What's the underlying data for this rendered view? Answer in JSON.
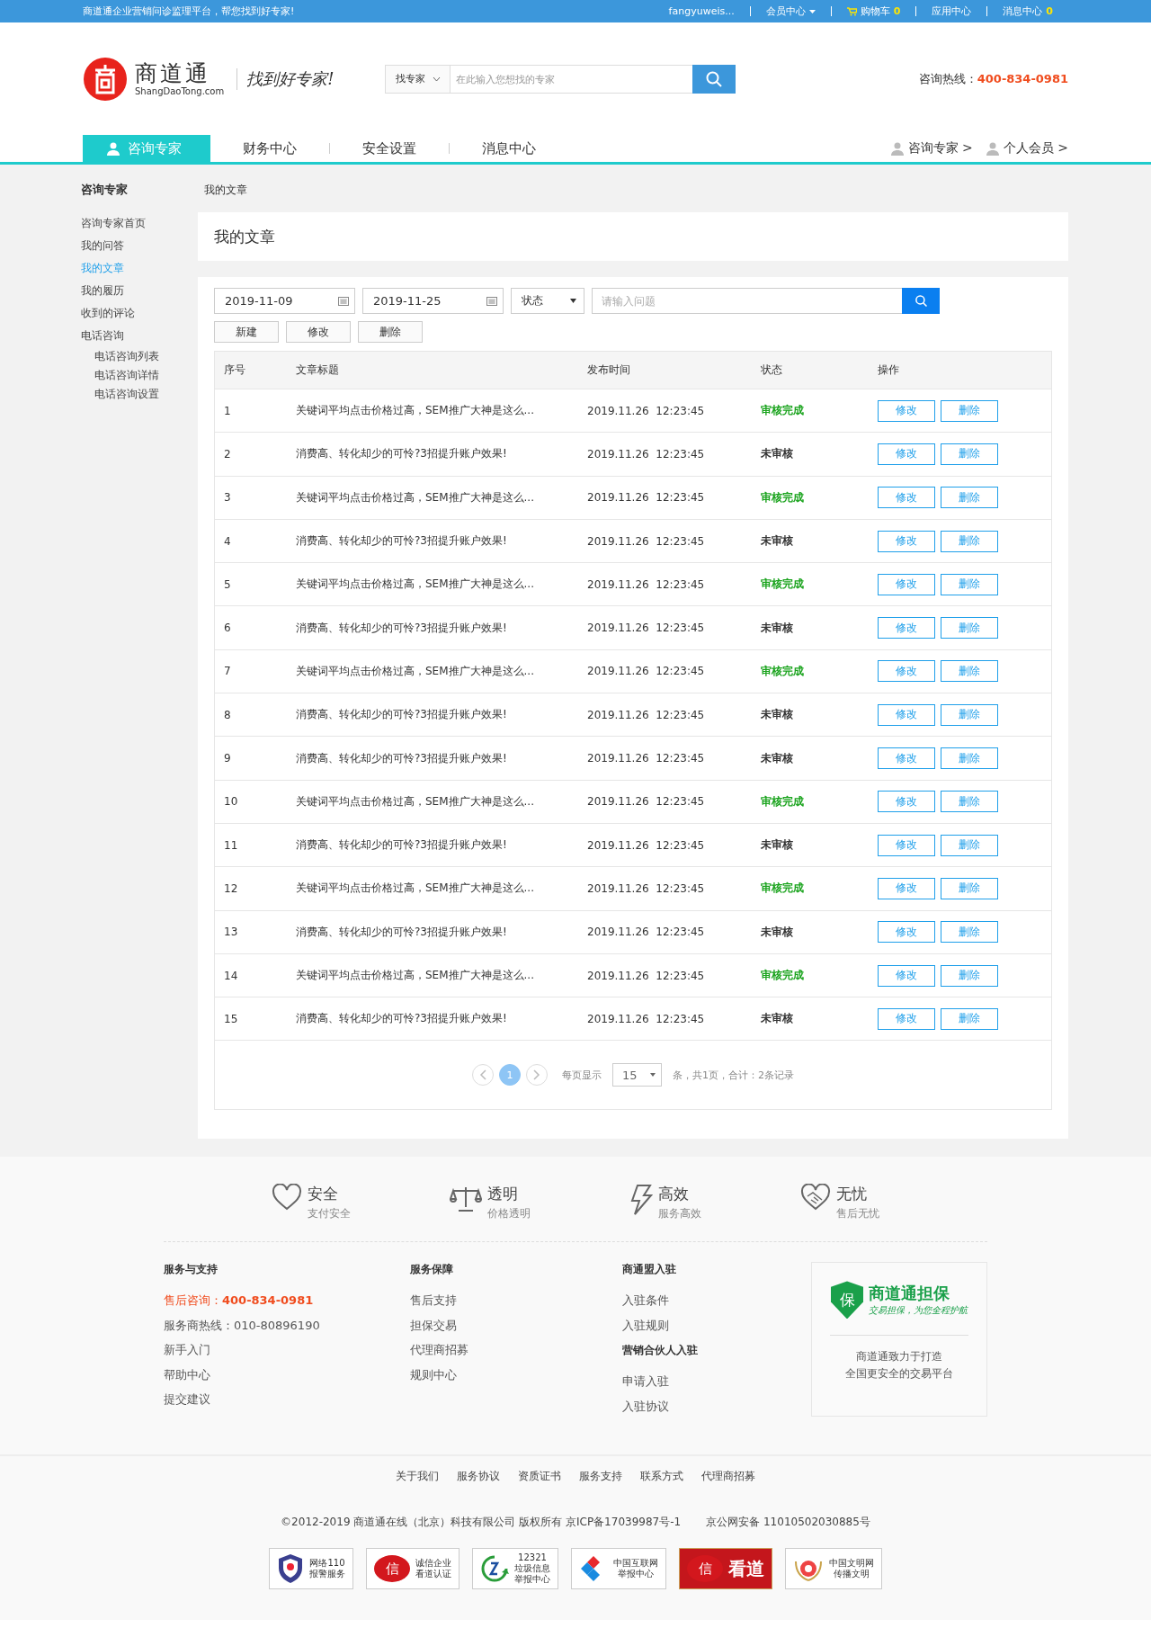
{
  "top_bar": {
    "slogan": "商道通企业营销问诊监理平台，帮您找到好专家!",
    "links": [
      {
        "kind": "text",
        "label": "fangyuweis..."
      },
      {
        "kind": "menu",
        "label": "会员中心"
      },
      {
        "kind": "cart",
        "label": "购物车",
        "count": "0"
      },
      {
        "kind": "text",
        "label": "应用中心"
      },
      {
        "kind": "count",
        "label": "消息中心",
        "count": "0"
      }
    ]
  },
  "header": {
    "logo": {
      "name": "商道通",
      "domain": "ShangDaoTong.com",
      "slogan": "找到好专家!"
    },
    "search": {
      "scope": "找专家",
      "placeholder": "在此输入您想找的专家"
    },
    "hotline": {
      "label": "咨询热线：",
      "number": "400-834-0981"
    }
  },
  "nav": {
    "tabs": [
      {
        "label": "咨询专家",
        "selected": true
      },
      {
        "label": "财务中心",
        "selected": false
      },
      {
        "label": "安全设置",
        "selected": false
      },
      {
        "label": "消息中心",
        "selected": false
      }
    ],
    "roles": [
      "咨询专家 >",
      "个人会员 >"
    ]
  },
  "sidebar": {
    "title": "咨询专家",
    "items": [
      {
        "label": "咨询专家首页",
        "selected": false
      },
      {
        "label": "我的问答",
        "selected": false
      },
      {
        "label": "我的文章",
        "selected": true
      },
      {
        "label": "我的履历",
        "selected": false
      },
      {
        "label": "收到的评论",
        "selected": false
      },
      {
        "label": "电话咨询",
        "selected": false,
        "children": [
          {
            "label": "电话咨询列表",
            "selected": false
          },
          {
            "label": "电话咨询详情",
            "selected": false
          },
          {
            "label": "电话咨询设置",
            "selected": false
          }
        ]
      }
    ]
  },
  "breadcrumb": "我的文章",
  "page_title": "我的文章",
  "filters": {
    "date_from": "2019-11-09",
    "date_to": "2019-11-25",
    "status": "状态",
    "search_placeholder": "请输入问题",
    "actions": [
      "新建",
      "修改",
      "删除"
    ]
  },
  "table": {
    "columns": [
      "序号",
      "文章标题",
      "发布时间",
      "状态",
      "操作"
    ],
    "rows": [
      {
        "no": "1",
        "title": "关键词平均点击价格过高，SEM推广大神是这么...",
        "date": "2019.11.26",
        "time": "12:23:45",
        "status": {
          "text": "审核完成",
          "color": "#19a31c"
        },
        "actions": [
          "修改",
          "删除"
        ]
      },
      {
        "no": "2",
        "title": "消费高、转化却少的可怜?3招提升账户效果!",
        "date": "2019.11.26",
        "time": "12:23:45",
        "status": {
          "text": "未审核",
          "color": "#333333"
        },
        "actions": [
          "修改",
          "删除"
        ]
      },
      {
        "no": "3",
        "title": "关键词平均点击价格过高，SEM推广大神是这么...",
        "date": "2019.11.26",
        "time": "12:23:45",
        "status": {
          "text": "审核完成",
          "color": "#19a31c"
        },
        "actions": [
          "修改",
          "删除"
        ]
      },
      {
        "no": "4",
        "title": "消费高、转化却少的可怜?3招提升账户效果!",
        "date": "2019.11.26",
        "time": "12:23:45",
        "status": {
          "text": "未审核",
          "color": "#333333"
        },
        "actions": [
          "修改",
          "删除"
        ]
      },
      {
        "no": "5",
        "title": "关键词平均点击价格过高，SEM推广大神是这么...",
        "date": "2019.11.26",
        "time": "12:23:45",
        "status": {
          "text": "审核完成",
          "color": "#19a31c"
        },
        "actions": [
          "修改",
          "删除"
        ]
      },
      {
        "no": "6",
        "title": "消费高、转化却少的可怜?3招提升账户效果!",
        "date": "2019.11.26",
        "time": "12:23:45",
        "status": {
          "text": "未审核",
          "color": "#333333"
        },
        "actions": [
          "修改",
          "删除"
        ]
      },
      {
        "no": "7",
        "title": "关键词平均点击价格过高，SEM推广大神是这么...",
        "date": "2019.11.26",
        "time": "12:23:45",
        "status": {
          "text": "审核完成",
          "color": "#19a31c"
        },
        "actions": [
          "修改",
          "删除"
        ]
      },
      {
        "no": "8",
        "title": "消费高、转化却少的可怜?3招提升账户效果!",
        "date": "2019.11.26",
        "time": "12:23:45",
        "status": {
          "text": "未审核",
          "color": "#333333"
        },
        "actions": [
          "修改",
          "删除"
        ]
      },
      {
        "no": "9",
        "title": "消费高、转化却少的可怜?3招提升账户效果!",
        "date": "2019.11.26",
        "time": "12:23:45",
        "status": {
          "text": "未审核",
          "color": "#333333"
        },
        "actions": [
          "修改",
          "删除"
        ]
      },
      {
        "no": "10",
        "title": "关键词平均点击价格过高，SEM推广大神是这么...",
        "date": "2019.11.26",
        "time": "12:23:45",
        "status": {
          "text": "审核完成",
          "color": "#19a31c"
        },
        "actions": [
          "修改",
          "删除"
        ]
      },
      {
        "no": "11",
        "title": "消费高、转化却少的可怜?3招提升账户效果!",
        "date": "2019.11.26",
        "time": "12:23:45",
        "status": {
          "text": "未审核",
          "color": "#333333"
        },
        "actions": [
          "修改",
          "删除"
        ]
      },
      {
        "no": "12",
        "title": "关键词平均点击价格过高，SEM推广大神是这么...",
        "date": "2019.11.26",
        "time": "12:23:45",
        "status": {
          "text": "审核完成",
          "color": "#19a31c"
        },
        "actions": [
          "修改",
          "删除"
        ]
      },
      {
        "no": "13",
        "title": "消费高、转化却少的可怜?3招提升账户效果!",
        "date": "2019.11.26",
        "time": "12:23:45",
        "status": {
          "text": "未审核",
          "color": "#333333"
        },
        "actions": [
          "修改",
          "删除"
        ]
      },
      {
        "no": "14",
        "title": "关键词平均点击价格过高，SEM推广大神是这么...",
        "date": "2019.11.26",
        "time": "12:23:45",
        "status": {
          "text": "审核完成",
          "color": "#19a31c"
        },
        "actions": [
          "修改",
          "删除"
        ]
      },
      {
        "no": "15",
        "title": "消费高、转化却少的可怜?3招提升账户效果!",
        "date": "2019.11.26",
        "time": "12:23:45",
        "status": {
          "text": "未审核",
          "color": "#333333"
        },
        "actions": [
          "修改",
          "删除"
        ]
      }
    ]
  },
  "pagination": {
    "pages": [
      {
        "label": "1",
        "selected": true
      }
    ],
    "per_page_label": "每页显示",
    "per_page": "15",
    "summary": "条，共1页，合计：2条记录"
  },
  "features": [
    {
      "kind": "heart",
      "title": "安全",
      "subtitle": "支付安全"
    },
    {
      "kind": "scale",
      "title": "透明",
      "subtitle": "价格透明"
    },
    {
      "kind": "bolt",
      "title": "高效",
      "subtitle": "服务高效"
    },
    {
      "kind": "handshake",
      "title": "无忧",
      "subtitle": "售后无忧"
    }
  ],
  "footer_columns": [
    {
      "sections": [
        {
          "title": "服务与支持",
          "links": [
            {
              "kind": "hotline",
              "label": "售后咨询：",
              "value": "400-834-0981"
            },
            {
              "kind": "link",
              "label": "服务商热线：010-80896190"
            },
            {
              "kind": "link",
              "label": "新手入门"
            },
            {
              "kind": "link",
              "label": "帮助中心"
            },
            {
              "kind": "link",
              "label": "提交建议"
            }
          ]
        }
      ]
    },
    {
      "sections": [
        {
          "title": "服务保障",
          "links": [
            {
              "kind": "link",
              "label": "售后支持"
            },
            {
              "kind": "link",
              "label": "担保交易"
            },
            {
              "kind": "link",
              "label": "代理商招募"
            },
            {
              "kind": "link",
              "label": "规则中心"
            }
          ]
        }
      ]
    },
    {
      "sections": [
        {
          "title": "商通盟入驻",
          "links": [
            {
              "kind": "link",
              "label": "入驻条件"
            },
            {
              "kind": "link",
              "label": "入驻规则"
            }
          ]
        },
        {
          "title": "营销合伙人入驻",
          "links": [
            {
              "kind": "link",
              "label": "申请入驻"
            },
            {
              "kind": "link",
              "label": "入驻协议"
            }
          ]
        }
      ]
    }
  ],
  "guarantee": {
    "badge": "保",
    "name": "商道通担保",
    "tagline": "交易担保，为您全程护航",
    "text": [
      "商道通致力于打造",
      "全国更安全的交易平台"
    ]
  },
  "bottom_links": [
    "关于我们",
    "服务协议",
    "资质证书",
    "服务支持",
    "联系方式",
    "代理商招募"
  ],
  "copyright": "©2012-2019 商道通在线（北京）科技有限公司 版权所有 京ICP备17039987号-1",
  "police_record": "京公网安备 11010502030885号",
  "trust_badges": [
    {
      "kind": "shield",
      "lines": [
        "网络110",
        "报警服务"
      ]
    },
    {
      "kind": "seal",
      "mark": "信",
      "lines": [
        "诚信企业",
        "看道认证"
      ]
    },
    {
      "kind": "recycle",
      "lines": [
        "12321",
        "垃圾信息",
        "举报中心"
      ]
    },
    {
      "kind": "diamond",
      "lines": [
        "中国互联网",
        "举报中心"
      ]
    },
    {
      "kind": "seal_red",
      "mark": "信",
      "lines": [
        "看道"
      ]
    },
    {
      "kind": "flower",
      "lines": [
        "中国文明网",
        "传播文明"
      ]
    }
  ]
}
